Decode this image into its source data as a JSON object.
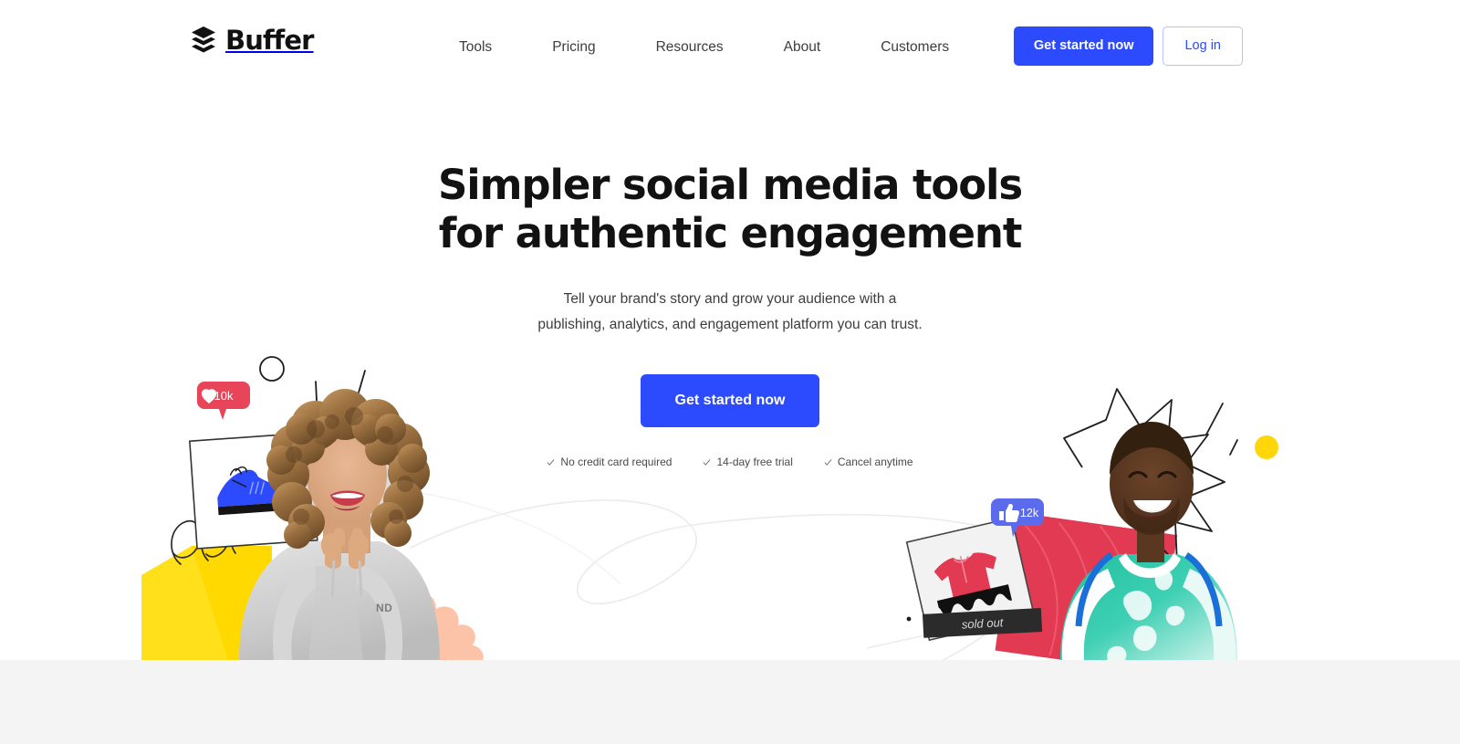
{
  "brand": {
    "name": "Buffer",
    "logo_icon": "buffer-stacked-layers-icon",
    "accent_color": "#2c4bff",
    "text_color": "#121212"
  },
  "header": {
    "nav_items": [
      {
        "label": "Tools"
      },
      {
        "label": "Pricing"
      },
      {
        "label": "Resources"
      },
      {
        "label": "About"
      },
      {
        "label": "Customers"
      }
    ],
    "primary_cta": "Get started now",
    "login_label": "Log in"
  },
  "hero": {
    "title_line1": "Simpler social media tools",
    "title_line2": "for authentic engagement",
    "sub_line1": "Tell your brand's story and grow your audience with a",
    "sub_line2": "publishing, analytics, and engagement platform you can trust.",
    "cta_label": "Get started now",
    "trust_items": [
      {
        "icon": "check-icon",
        "label": "No credit card required"
      },
      {
        "icon": "check-icon",
        "label": "14-day free trial"
      },
      {
        "icon": "check-icon",
        "label": "Cancel anytime"
      }
    ]
  },
  "illustration_left": {
    "description": "Laughing woman with curly hair in grey hoodie",
    "like_badge": {
      "icon": "heart-icon",
      "count": "10k",
      "color": "#e8445a"
    },
    "product_card": {
      "item": "blue-sneaker-icon",
      "color": "#2c4bff"
    },
    "shapes": {
      "bag_color": "#ffe01b",
      "blob_color": "#fcc3a9",
      "circle_outline_color": "#1a1a1a",
      "sketch_color": "#1a1a1a"
    }
  },
  "illustration_right": {
    "description": "Smiling man in teal and white raglan shirt",
    "like_badge": {
      "icon": "thumbs-up-icon",
      "count": "12k",
      "color": "#5b6bec"
    },
    "product_card": {
      "item": "red-shirt-icon",
      "banner_text": "sold out",
      "color": "#e23a52"
    },
    "shapes": {
      "red_shape_color": "#e23a52",
      "dot_color": "#ffd60a",
      "burst_outline_color": "#1a1a1a"
    }
  },
  "bottom_band": {
    "background_color": "#f4f4f4"
  }
}
